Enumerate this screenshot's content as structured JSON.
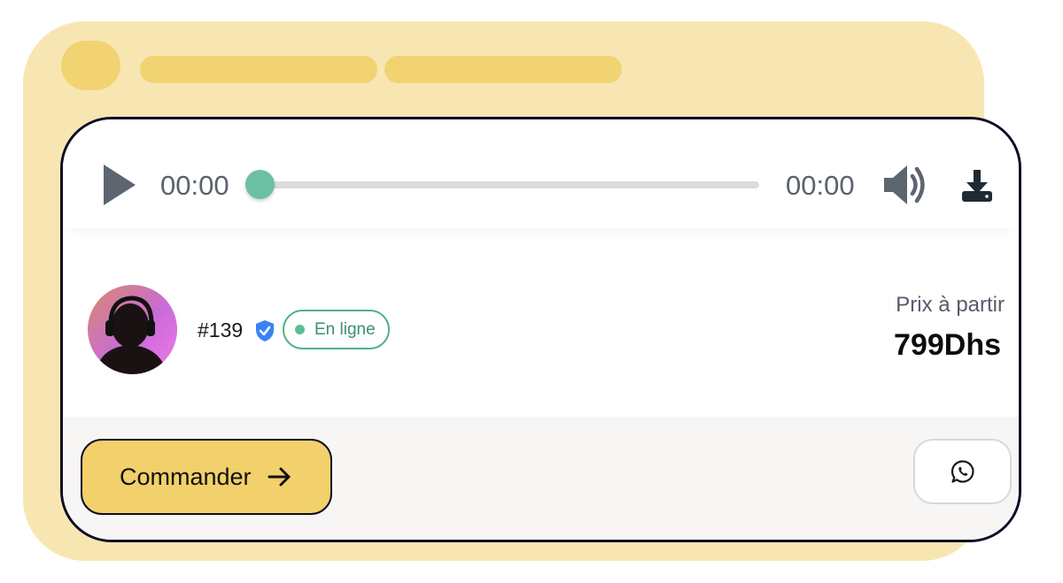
{
  "player": {
    "current_time": "00:00",
    "duration": "00:00",
    "progress": 0,
    "play_icon": "play-icon",
    "volume_icon": "volume-icon",
    "download_icon": "download-icon"
  },
  "vendor": {
    "id": "#139",
    "verified_icon": "verified-shield-icon",
    "status": "En ligne"
  },
  "price": {
    "label": "Prix à partir",
    "value": "799Dhs"
  },
  "actions": {
    "order_label": "Commander",
    "order_icon": "arrow-right-icon",
    "whatsapp_icon": "whatsapp-icon"
  },
  "colors": {
    "backdrop": "#f8e6b2",
    "accent_yellow": "#f2d06b",
    "online_green": "#4fb28a",
    "progress_thumb": "#6cc0a4",
    "verified_blue": "#3b82f6"
  }
}
